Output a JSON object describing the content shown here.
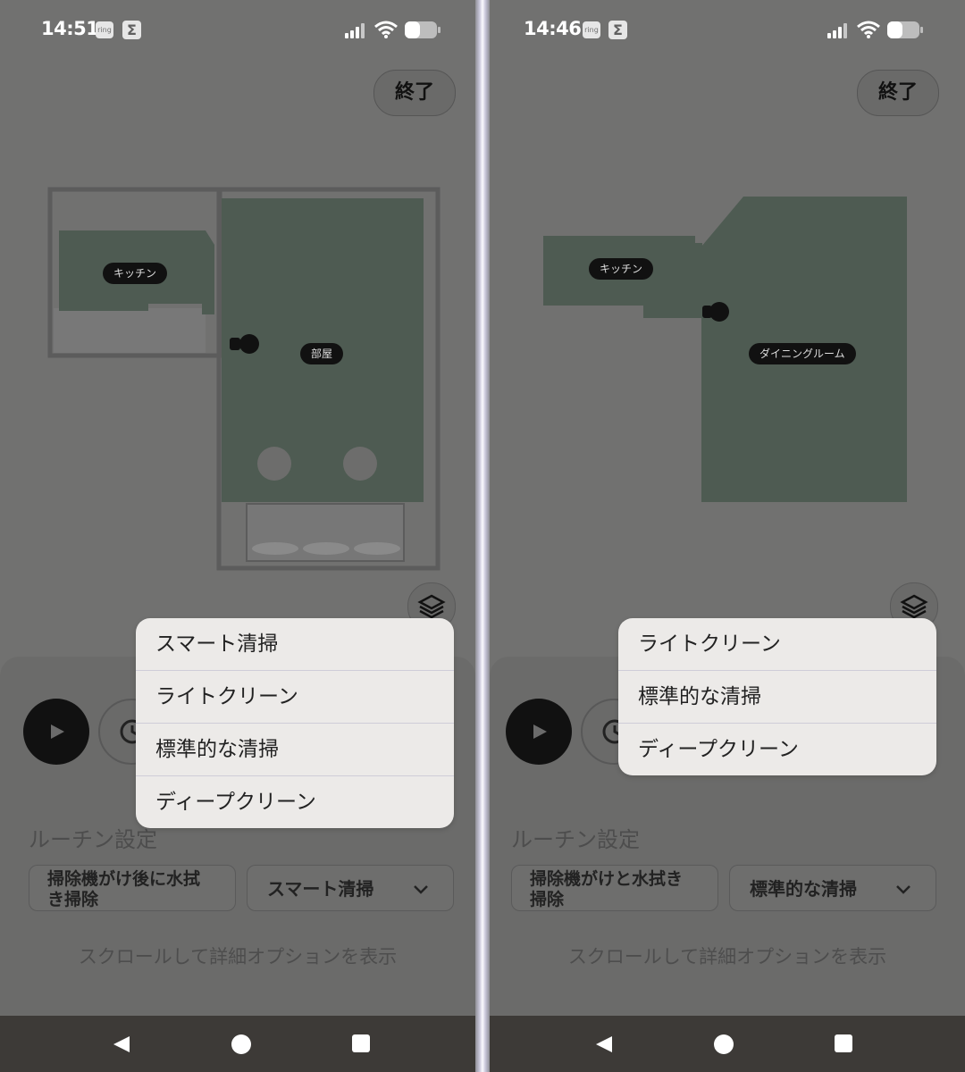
{
  "screens": [
    {
      "status": {
        "time": "14:51",
        "ring_label": "ring",
        "sigma": "Σ"
      },
      "end_button": "終了",
      "rooms": [
        "キッチン",
        "部屋"
      ],
      "dropdown_options": [
        "スマート清掃",
        "ライトクリーン",
        "標準的な清掃",
        "ディープクリーン"
      ],
      "routine_title": "ルーチン設定",
      "mode_line1": "掃除機がけ後に水拭",
      "mode_line2": "き掃除",
      "intensity_value": "スマート清掃",
      "scroll_hint": "スクロールして詳細オプションを表示"
    },
    {
      "status": {
        "time": "14:46",
        "ring_label": "ring",
        "sigma": "Σ"
      },
      "end_button": "終了",
      "rooms": [
        "キッチン",
        "ダイニングルーム"
      ],
      "dropdown_options": [
        "ライトクリーン",
        "標準的な清掃",
        "ディープクリーン"
      ],
      "routine_title": "ルーチン設定",
      "mode_line1": "掃除機がけと水拭き",
      "mode_line2": "掃除",
      "intensity_value": "標準的な清掃",
      "scroll_hint": "スクロールして詳細オプションを表示"
    }
  ],
  "colors": {
    "room_fill": "#4e5b52",
    "dim_background": "#717170",
    "menu_bg": "#eceae8"
  },
  "icons": [
    "ring-icon",
    "sigma-icon",
    "signal-icon",
    "wifi-icon",
    "battery-icon",
    "layers-icon",
    "play-icon",
    "clock-icon",
    "chevron-down-icon",
    "nav-back-icon",
    "nav-home-icon",
    "nav-recents-icon"
  ]
}
